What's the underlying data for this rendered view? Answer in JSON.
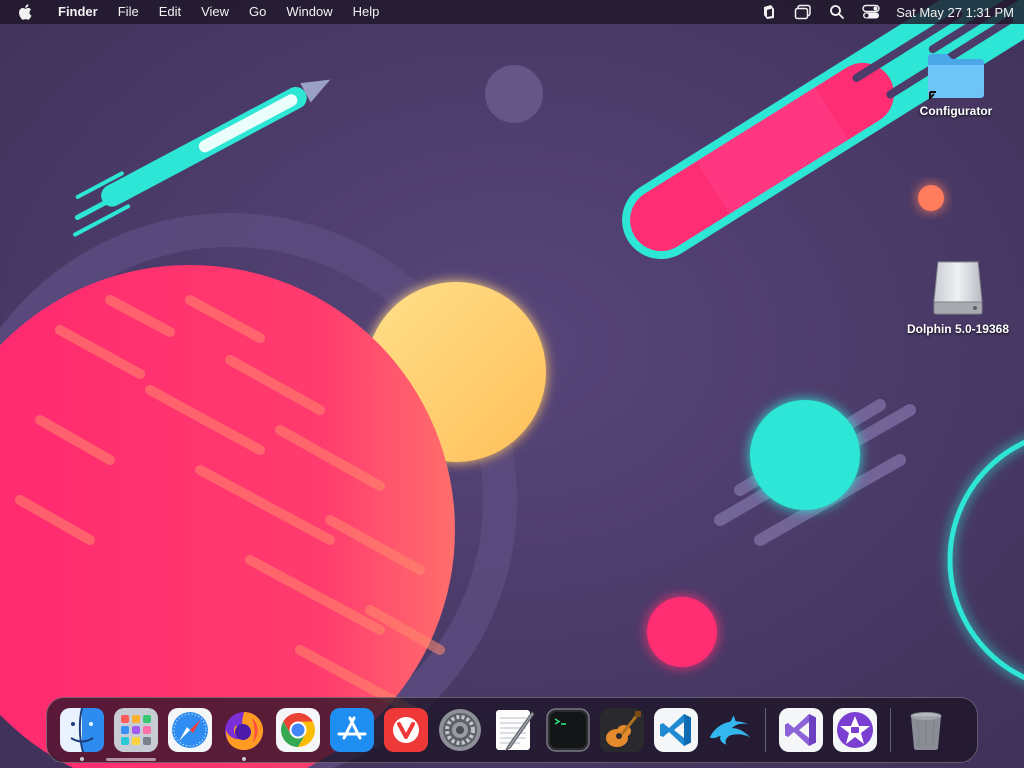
{
  "menubar": {
    "active_app": "Finder",
    "menus": [
      "File",
      "Edit",
      "View",
      "Go",
      "Window",
      "Help"
    ],
    "clock": "Sat May 27  1:31 PM",
    "status_icons": [
      "scrobbles-icon",
      "window-icon",
      "search-icon",
      "control-center-icon"
    ]
  },
  "desktop": {
    "icons": [
      {
        "label": "Configurator",
        "icon": "folder-icon"
      },
      {
        "label": "Dolphin 5.0-19368",
        "icon": "disk-image-icon"
      }
    ]
  },
  "dock": {
    "apps": [
      {
        "name": "finder",
        "running": true
      },
      {
        "name": "launchpad",
        "running": false
      },
      {
        "name": "safari",
        "running": false
      },
      {
        "name": "firefox",
        "running": true
      },
      {
        "name": "chrome",
        "running": false
      },
      {
        "name": "app-store",
        "running": false
      },
      {
        "name": "vivaldi",
        "running": false
      },
      {
        "name": "system-preferences",
        "running": false
      },
      {
        "name": "textedit",
        "running": false
      },
      {
        "name": "terminal",
        "running": false
      },
      {
        "name": "garageband",
        "running": false
      },
      {
        "name": "vscode",
        "running": false
      },
      {
        "name": "dolphin",
        "running": false
      }
    ],
    "recent": [
      {
        "name": "visual-studio"
      },
      {
        "name": "imovie"
      }
    ],
    "trash": {
      "name": "trash"
    }
  },
  "colors": {
    "wallpaper_bg": "#4b3c6a",
    "accent_pink": "#ff2d73",
    "accent_cyan": "#2ee6d6",
    "accent_yellow": "#ffd36e"
  }
}
